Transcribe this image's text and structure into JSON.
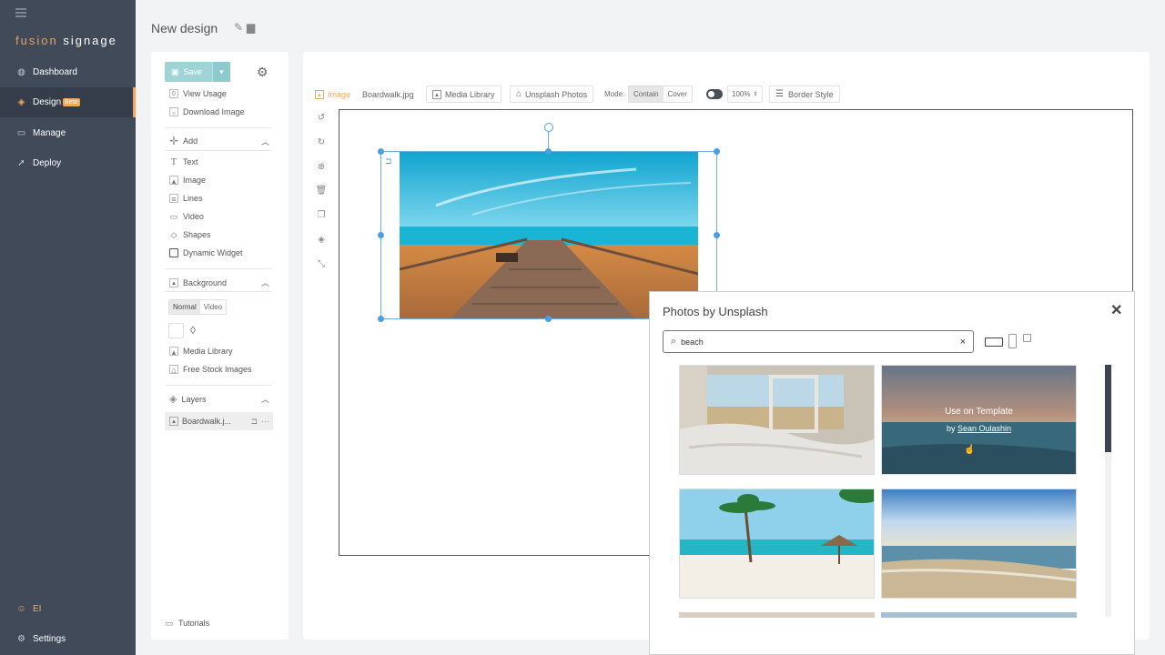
{
  "app": {
    "logo_part1": "fusion",
    "logo_part2": "signage",
    "page_title": "New design"
  },
  "sidebar": {
    "items": [
      {
        "label": "Dashboard",
        "icon": "globe-icon"
      },
      {
        "label": "Design",
        "badge": "Beta",
        "icon": "palette-icon"
      },
      {
        "label": "Manage",
        "icon": "folder-icon"
      },
      {
        "label": "Deploy",
        "icon": "rocket-icon"
      }
    ],
    "user": "EI",
    "settings": "Settings",
    "accent": "#f5a660"
  },
  "left_panel": {
    "save_label": "Save",
    "view_usage_count": "0",
    "view_usage": "View Usage",
    "download_image": "Download Image",
    "add_header": "Add",
    "add_items": [
      "Text",
      "Image",
      "Lines",
      "Video",
      "Shapes",
      "Dynamic Widget"
    ],
    "background_header": "Background",
    "bg_tabs": [
      "Normal",
      "Video"
    ],
    "media_library": "Media Library",
    "free_stock": "Free Stock Images",
    "layers_header": "Layers",
    "layer_name": "Boardwalk.j...",
    "tutorials": "Tutorials"
  },
  "toolbar": {
    "image_label": "Image",
    "filename": "Boardwalk.jpg",
    "media_library": "Media Library",
    "unsplash": "Unsplash Photos",
    "mode_label": "Mode:",
    "mode_contain": "Contain",
    "mode_cover": "Cover",
    "opacity": "100%",
    "border_style": "Border Style"
  },
  "modal": {
    "title": "Photos by Unsplash",
    "search_value": "beach",
    "clear": "×",
    "close": "✕",
    "overlay_action": "Use on Template",
    "overlay_by": "by",
    "overlay_author": "Sean Oulashin"
  }
}
